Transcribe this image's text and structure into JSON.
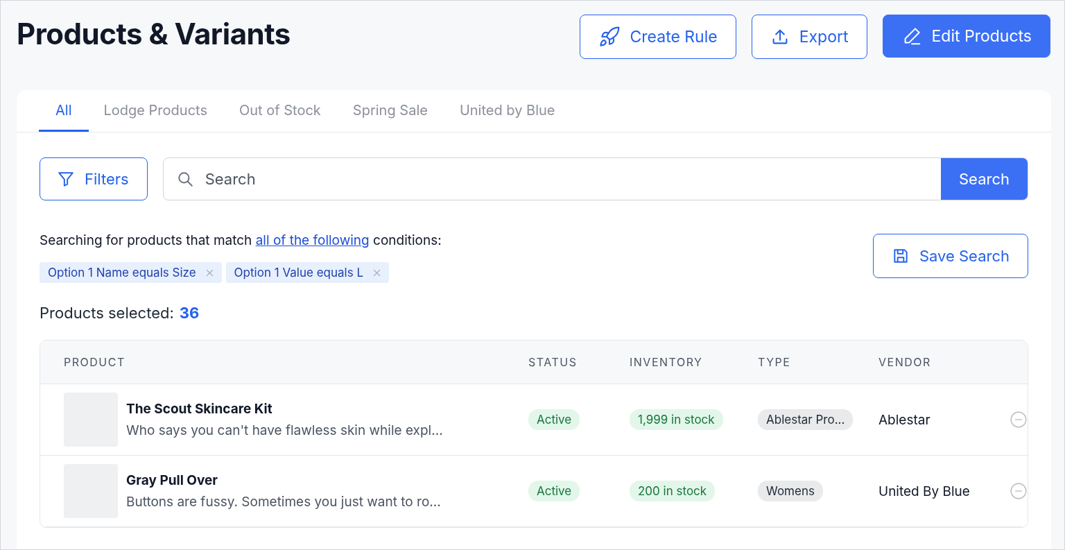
{
  "page": {
    "title": "Products & Variants"
  },
  "actions": [
    {
      "label": "Create Rule",
      "kind": "rule",
      "primary": false
    },
    {
      "label": "Export",
      "kind": "export",
      "primary": false
    },
    {
      "label": "Edit Products",
      "kind": "edit",
      "primary": true
    }
  ],
  "tabs": [
    {
      "label": "All",
      "selected": true
    },
    {
      "label": "Lodge Products",
      "selected": false
    },
    {
      "label": "Out of Stock",
      "selected": false
    },
    {
      "label": "Spring Sale",
      "selected": false
    },
    {
      "label": "United by Blue",
      "selected": false
    }
  ],
  "filters_button": "Filters",
  "search": {
    "placeholder": "Search",
    "button": "Search"
  },
  "conditions_text": {
    "before": "Searching for products that match ",
    "link": "all of the following",
    "after": " conditions:"
  },
  "conditions": [
    "Option 1 Name equals Size",
    "Option 1 Value equals L"
  ],
  "save_search": "Save Search",
  "selected_count": {
    "label": "Products selected:",
    "value": "36"
  },
  "table": {
    "columns": [
      "PRODUCT",
      "STATUS",
      "INVENTORY",
      "TYPE",
      "VENDOR"
    ],
    "rows": [
      {
        "name": "The Scout Skincare Kit",
        "description": "Who says you can't have flawless skin while expl...",
        "status": "Active",
        "inventory": "1,999 in stock",
        "type": "Ablestar Pro...",
        "vendor": "Ablestar"
      },
      {
        "name": "Gray Pull Over",
        "description": "Buttons are fussy. Sometimes you just want to ro...",
        "status": "Active",
        "inventory": "200 in stock",
        "type": "Womens",
        "vendor": "United By Blue"
      }
    ]
  }
}
